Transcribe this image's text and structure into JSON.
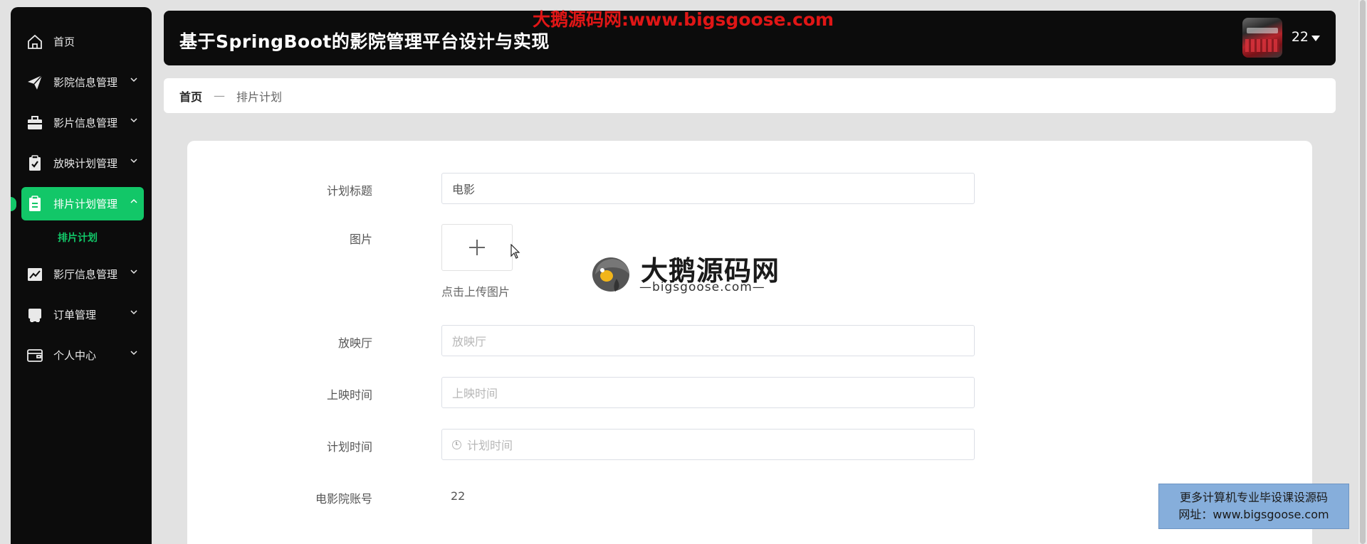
{
  "watermark_top": "大鹅源码网:www.bigsgoose.com",
  "sidebar": {
    "items": [
      {
        "label": "首页",
        "icon": "home-icon",
        "expandable": false
      },
      {
        "label": "影院信息管理",
        "icon": "send-icon",
        "expandable": true
      },
      {
        "label": "影片信息管理",
        "icon": "briefcase-icon",
        "expandable": true
      },
      {
        "label": "放映计划管理",
        "icon": "clipboard-check-icon",
        "expandable": true
      },
      {
        "label": "排片计划管理",
        "icon": "clipboard-icon",
        "expandable": true,
        "active": true
      },
      {
        "label": "影厅信息管理",
        "icon": "chart-icon",
        "expandable": true
      },
      {
        "label": "订单管理",
        "icon": "inbox-icon",
        "expandable": true
      },
      {
        "label": "个人中心",
        "icon": "wallet-icon",
        "expandable": true
      }
    ],
    "submenu": {
      "label": "排片计划"
    }
  },
  "header": {
    "title": "基于SpringBoot的影院管理平台设计与实现",
    "user_name": "22"
  },
  "breadcrumb": {
    "home": "首页",
    "separator": "—",
    "current": "排片计划"
  },
  "form": {
    "title_label": "计划标题",
    "title_value": "电影",
    "image_label": "图片",
    "upload_tip": "点击上传图片",
    "hall_label": "放映厅",
    "hall_placeholder": "放映厅",
    "showtime_label": "上映时间",
    "showtime_placeholder": "上映时间",
    "plantime_label": "计划时间",
    "plantime_placeholder": "计划时间",
    "account_label": "电影院账号",
    "account_value": "22"
  },
  "logo_watermark": {
    "big": "大鹅源码网",
    "small": "—bigsgoose.com—"
  },
  "promo": {
    "line1": "更多计算机专业毕设课设源码",
    "line2": "网址：www.bigsgoose.com"
  },
  "colors": {
    "accent": "#12c768",
    "sidebar_bg": "#0c0c0c",
    "header_bg": "#0c0c0c",
    "watermark_red": "#e01616",
    "promo_bg": "#86aedb"
  }
}
